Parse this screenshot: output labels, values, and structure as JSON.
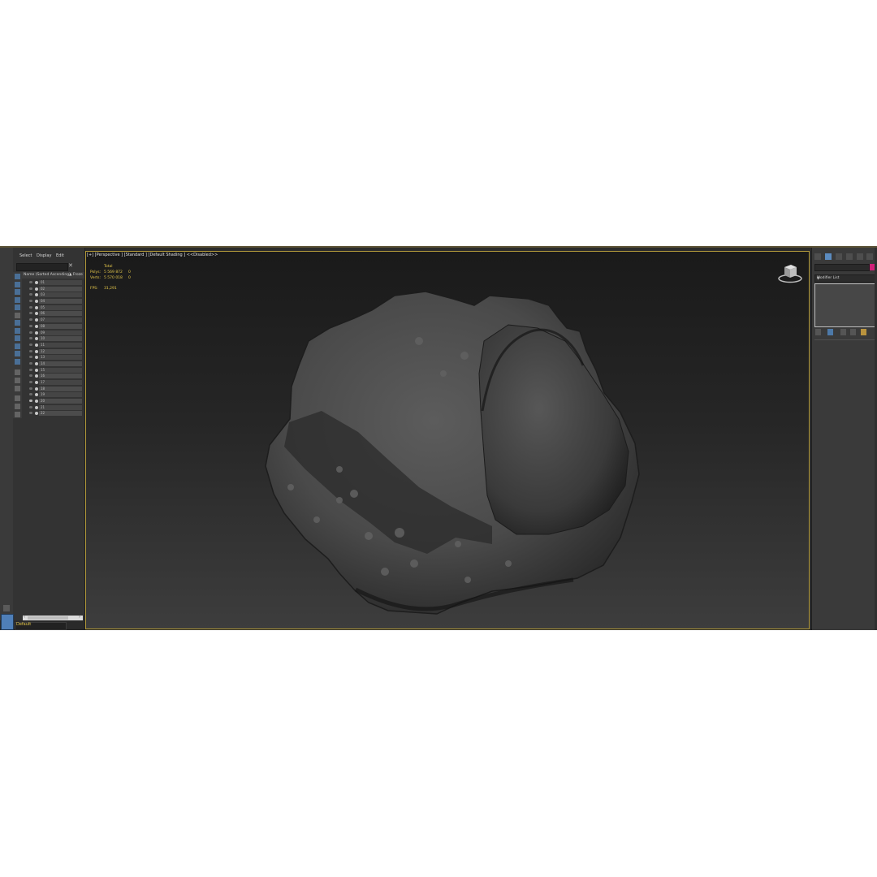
{
  "scene_explorer": {
    "menu": [
      "Select",
      "Display",
      "Edit"
    ],
    "clear_icon": "close-icon",
    "columns": {
      "name": "Name (Sorted Ascending)",
      "second": "▲ Froze"
    },
    "objects": [
      "01",
      "02",
      "03",
      "04",
      "05",
      "06",
      "07",
      "08",
      "09",
      "10",
      "11",
      "12",
      "13",
      "14",
      "15",
      "16",
      "17",
      "18",
      "19",
      "20",
      "21",
      "22"
    ],
    "visible_object": "20"
  },
  "layer": {
    "current": "Default"
  },
  "viewport": {
    "label": "[+] [Perspective ] [Standard ] [Default Shading ]  <<Disabled>>",
    "stats": {
      "header": "Total",
      "polys_label": "Polys:",
      "polys_value": "5 569 872",
      "polys_sel": "0",
      "verts_label": "Verts:",
      "verts_value": "5 570 018",
      "verts_sel": "0",
      "fps_label": "FPS:",
      "fps_value": "31,291"
    },
    "stats_color": "#e6c84a",
    "border_color": "#b39a3a",
    "viewcube_icon": "viewcube-icon"
  },
  "command_panel": {
    "modifier_list": "Modifier List",
    "object_color": "#d21e78"
  }
}
